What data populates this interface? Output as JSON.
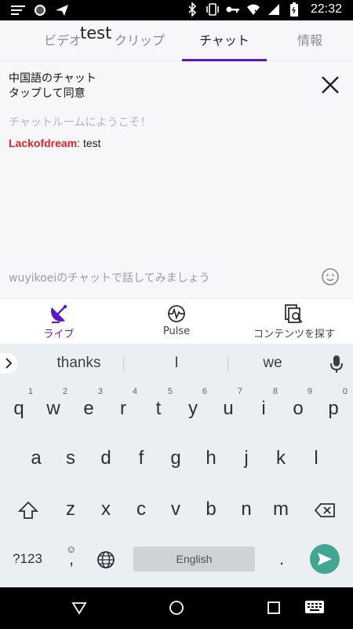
{
  "status_bar": {
    "time": "22:32",
    "icons": [
      "menu-lines-icon",
      "circle-icon",
      "send-icon",
      "bluetooth-icon",
      "vibrate-icon",
      "key-icon",
      "wifi-icon",
      "signal-icon",
      "battery-icon"
    ]
  },
  "overlay_text": "test",
  "tabs": [
    {
      "label": "ビデオ",
      "active": false
    },
    {
      "label": "クリップ",
      "active": false
    },
    {
      "label": "チャット",
      "active": true
    },
    {
      "label": "情報",
      "active": false
    }
  ],
  "chat": {
    "notice_line1": "中国語のチャット",
    "notice_line2": "タップして同意",
    "welcome": "チャットルームにようこそ！",
    "messages": [
      {
        "user": "Lackofdream",
        "separator": ": ",
        "text": "test"
      }
    ],
    "input_placeholder": "wuyikoeiのチャットで話してみましょう"
  },
  "bottom_nav": [
    {
      "label": "ライブ",
      "icon": "broadcast-icon",
      "active": true
    },
    {
      "label": "Pulse",
      "icon": "pulse-icon",
      "active": false
    },
    {
      "label": "コンテンツを探す",
      "icon": "browse-search-icon",
      "active": false
    }
  ],
  "keyboard": {
    "suggestions": [
      "thanks",
      "I",
      "we"
    ],
    "row1": [
      {
        "key": "q",
        "hint": "1"
      },
      {
        "key": "w",
        "hint": "2"
      },
      {
        "key": "e",
        "hint": "3"
      },
      {
        "key": "r",
        "hint": "4"
      },
      {
        "key": "t",
        "hint": "5"
      },
      {
        "key": "y",
        "hint": "6"
      },
      {
        "key": "u",
        "hint": "7"
      },
      {
        "key": "i",
        "hint": "8"
      },
      {
        "key": "o",
        "hint": "9"
      },
      {
        "key": "p",
        "hint": "0"
      }
    ],
    "row2": [
      "a",
      "s",
      "d",
      "f",
      "g",
      "h",
      "j",
      "k",
      "l"
    ],
    "row3": [
      "z",
      "x",
      "c",
      "v",
      "b",
      "n",
      "m"
    ],
    "symbols_label": "?123",
    "comma": ",",
    "period": ".",
    "space_label": "English"
  },
  "colors": {
    "accent": "#5c16c5",
    "username": "#e0242c",
    "send_button": "#43a692"
  }
}
